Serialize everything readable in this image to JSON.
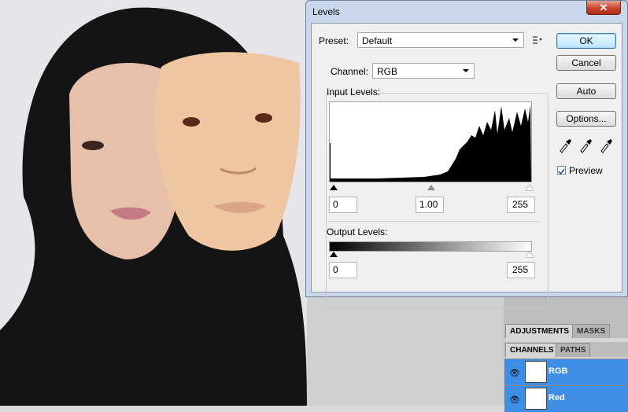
{
  "dialog": {
    "title": "Levels",
    "close_label": "✕",
    "preset_label": "Preset:",
    "preset_value": "Default",
    "channel_label": "Channel:",
    "channel_value": "RGB",
    "input_levels_label": "Input Levels:",
    "input_black": "0",
    "input_gamma": "1.00",
    "input_white": "255",
    "output_levels_label": "Output Levels:",
    "output_black": "0",
    "output_white": "255",
    "buttons": {
      "ok": "OK",
      "cancel": "Cancel",
      "auto": "Auto",
      "options": "Options..."
    },
    "preview_label": "Preview",
    "preview_checked": true
  },
  "panels": {
    "tabs_top": [
      "ADJUSTMENTS",
      "MASKS"
    ],
    "tabs_bottom": [
      "CHANNELS",
      "PATHS"
    ],
    "channels": [
      {
        "label": "RGB",
        "selected": true
      },
      {
        "label": "Red",
        "selected": true
      }
    ]
  },
  "colors": {
    "selection": "#3d8ee4",
    "close": "#c7442c",
    "dialog_frame": "#c8d7ea"
  }
}
